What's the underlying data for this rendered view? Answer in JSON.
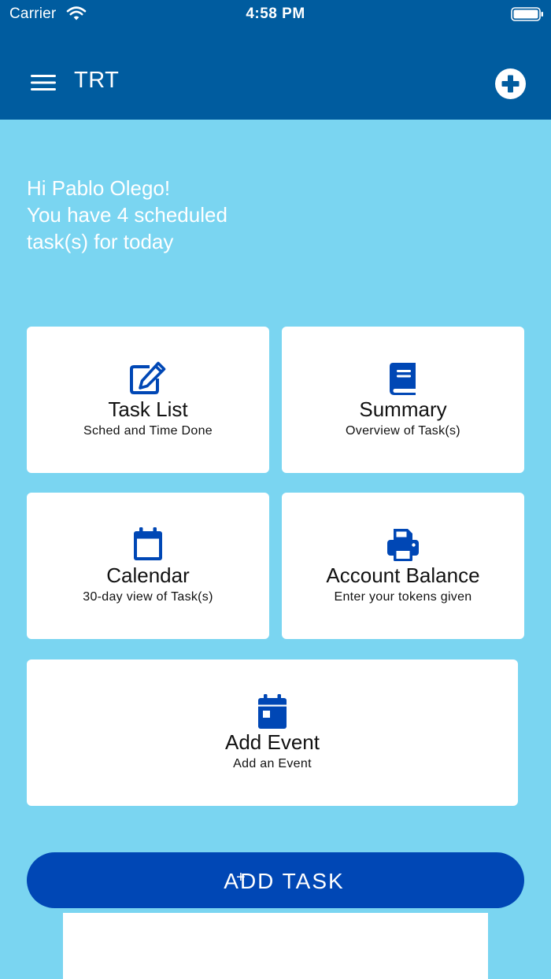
{
  "status_bar": {
    "carrier": "Carrier",
    "time": "4:58 PM"
  },
  "header": {
    "title": "TRT",
    "menu_icon": "hamburger-menu-icon",
    "add_icon": "plus-circle-icon"
  },
  "greeting": {
    "line1": "Hi Pablo Olego!",
    "line2": "You have 4 scheduled",
    "line3": "task(s) for today"
  },
  "cards": {
    "task_list": {
      "title": "Task List",
      "subtitle": "Sched and Time Done",
      "icon": "edit-icon"
    },
    "summary": {
      "title": "Summary",
      "subtitle": "Overview of Task(s)",
      "icon": "book-icon"
    },
    "calendar": {
      "title": "Calendar",
      "subtitle": "30-day view of Task(s)",
      "icon": "calendar-icon"
    },
    "account_balance": {
      "title": "Account Balance",
      "subtitle": "Enter your tokens given",
      "icon": "printer-icon"
    },
    "add_event": {
      "title": "Add Event",
      "subtitle": "Add an Event",
      "icon": "calendar-day-icon"
    }
  },
  "add_task_button": {
    "plus": "+",
    "label": "ADD TASK"
  },
  "colors": {
    "header": "#005c9f",
    "background": "#7ad5f1",
    "accent": "#0047b5",
    "card": "#ffffff"
  }
}
